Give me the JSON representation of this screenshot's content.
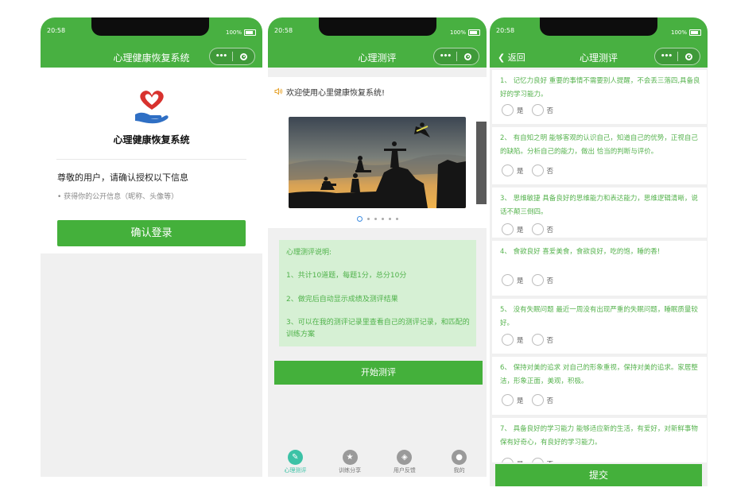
{
  "status_bar": {
    "time": "20:58",
    "battery": "100%"
  },
  "capsule": {
    "more": "•••"
  },
  "screen1": {
    "title": "心理健康恢复系统",
    "app_name": "心理健康恢复系统",
    "greeting": "尊敬的用户，请确认授权以下信息",
    "permission": "• 获得你的公开信息（昵称、头像等）",
    "login_button": "确认登录"
  },
  "screen2": {
    "title": "心理测评",
    "notice": "欢迎使用心里健康恢复系统!",
    "carousel": {
      "count": 6,
      "active": 0
    },
    "description": [
      "心理测评说明:",
      "1、共计10道题，每题1分，总分10分",
      "2、做完后自动显示成绩及测评结果",
      "3、可以在我的测评记录里查看自己的测评记录，和匹配的训练方案"
    ],
    "start_button": "开始测评",
    "tabs": [
      {
        "label": "心理测评",
        "icon": "edit-icon",
        "active": true
      },
      {
        "label": "训练分享",
        "icon": "star-icon",
        "active": false
      },
      {
        "label": "用户反馈",
        "icon": "feedback-icon",
        "active": false
      },
      {
        "label": "我的",
        "icon": "user-icon",
        "active": false
      }
    ]
  },
  "screen3": {
    "title": "心理测评",
    "back": "返回",
    "questions": [
      {
        "text": "1、 记忆力良好 重要的事情不需要别人提醒，不会丢三落四,具备良好的学习能力。"
      },
      {
        "text": "2、 有自知之明 能够客观的认识自己，知道自己的优势，正视自己的缺陷。分析自己的能力，做出 恰当的判断与评价。"
      },
      {
        "text": "3、 思维敏捷 具备良好的思维能力和表达能力，思维逻辑清晰，说话不颠三倒四。"
      },
      {
        "text": "4、 食欲良好 喜爱美食，食欲良好，吃的饱，睡的香!"
      },
      {
        "text": "5、 没有失眠问题 最近一周没有出现严重的失眠问题，睡眠质量较好。"
      },
      {
        "text": "6、 保持对美的追求 对自己的形象重视，保持对美的追求。家居整洁，形象正面，美观，积极。"
      },
      {
        "text": "7、 具备良好的学习能力 能够适应新的生活，有爱好，对新鲜事物保有好奇心，有良好的学习能力。"
      }
    ],
    "option_yes": "是",
    "option_no": "否",
    "submit_button": "提交"
  },
  "colors": {
    "primary": "#48b041",
    "accent": "#3cc2a6",
    "question_text": "#57b34f"
  }
}
